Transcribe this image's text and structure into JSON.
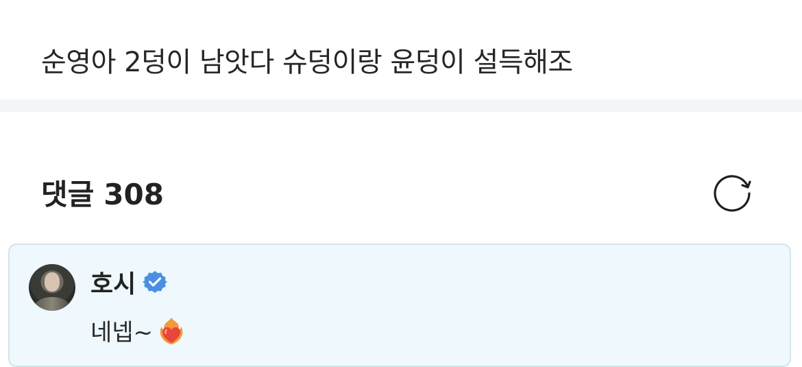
{
  "post": {
    "title": "순영아 2덩이 남앗다 슈덩이랑 윤덩이 설득해조"
  },
  "comments_header": {
    "label": "댓글",
    "count": "308"
  },
  "comment": {
    "author": "호시",
    "verified": true,
    "text": "네넵~",
    "emoji_icon": "heart-on-fire-icon"
  },
  "colors": {
    "accent_blue": "#4a90e2",
    "card_background": "#eef8fd",
    "card_border": "#cfe5ee",
    "divider": "#f4f5f9"
  }
}
